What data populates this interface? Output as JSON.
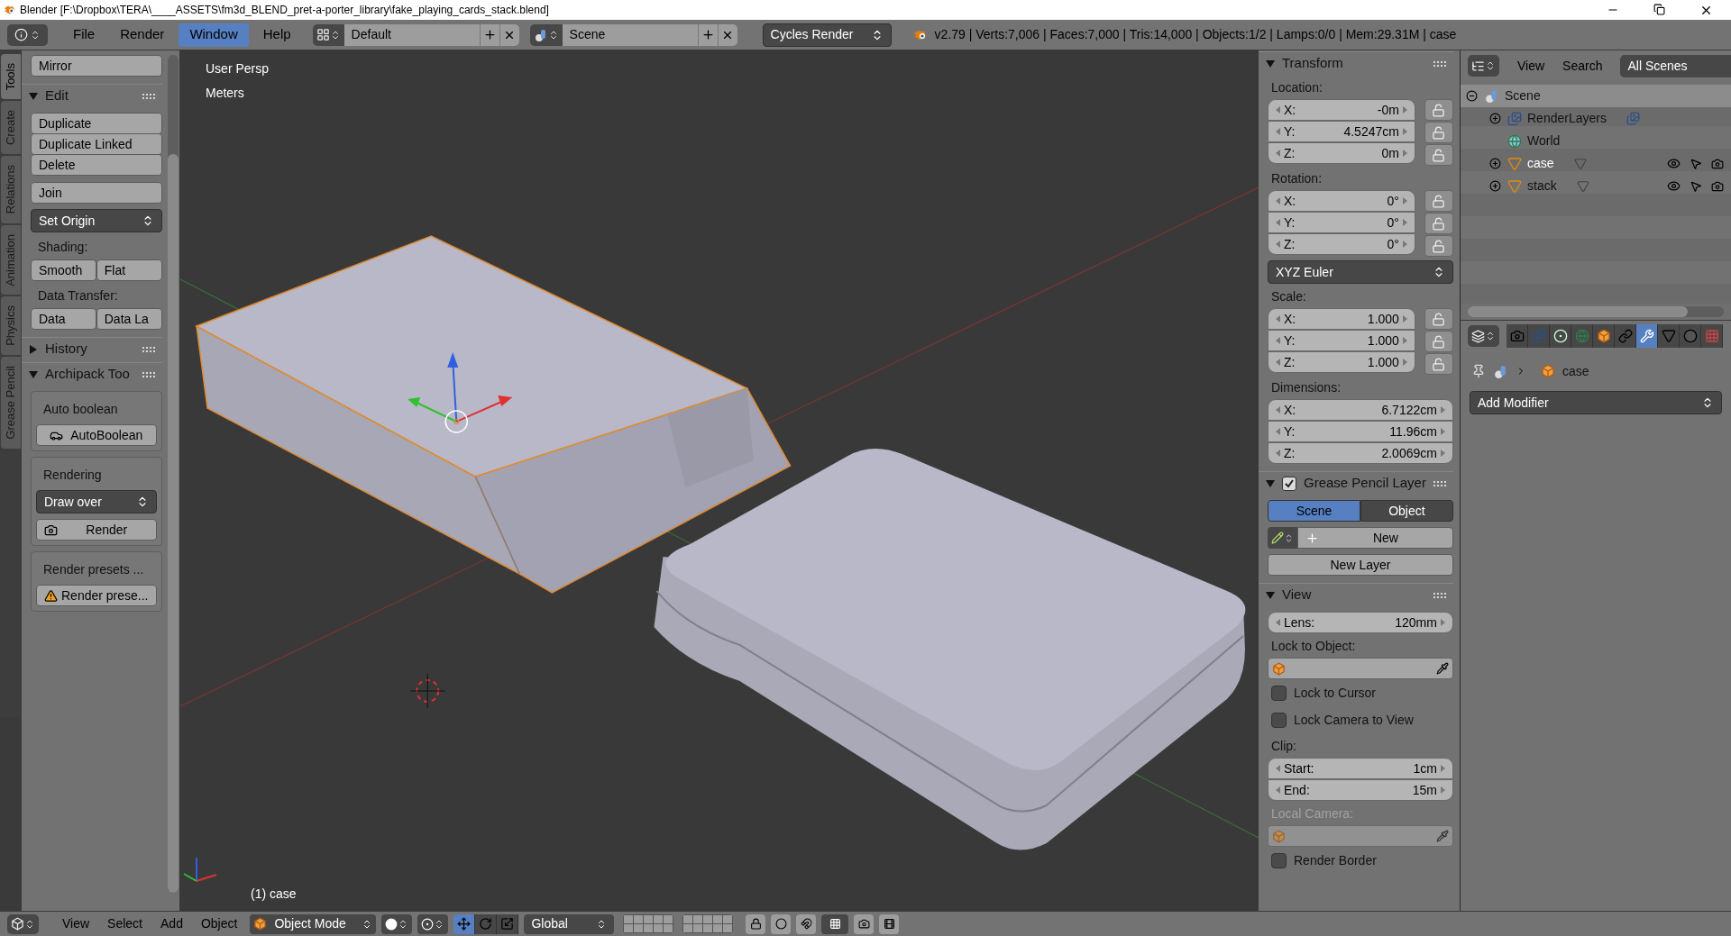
{
  "title_bar": {
    "title": "Blender [F:\\Dropbox\\TERA\\____ASSETS\\fm3d_BLEND_pret-a-porter_library\\fake_playing_cards_stack.blend]"
  },
  "menu": [
    {
      "label": "File",
      "selected": false
    },
    {
      "label": "Render",
      "selected": false
    },
    {
      "label": "Window",
      "selected": true
    },
    {
      "label": "Help",
      "selected": false
    }
  ],
  "screen_layout": "Default",
  "scene": "Scene",
  "render_engine": "Cycles Render",
  "stats": "v2.79 | Verts:7,006 | Faces:7,000 | Tris:14,000 | Objects:1/2 | Lamps:0/0 | Mem:29.31M | case",
  "tool_tabs": [
    {
      "label": "Tools",
      "selected": true
    },
    {
      "label": "Create",
      "selected": false
    },
    {
      "label": "Relations",
      "selected": false
    },
    {
      "label": "Animation",
      "selected": false
    },
    {
      "label": "Physics",
      "selected": false
    },
    {
      "label": "Grease Pencil",
      "selected": false
    }
  ],
  "tools": {
    "top_button": "Mirror",
    "edit": {
      "title": "Edit",
      "expanded": true,
      "buttons": [
        "Duplicate",
        "Duplicate Linked",
        "Delete"
      ],
      "join": "Join",
      "set_origin": "Set Origin",
      "shading_label": "Shading:",
      "shading": [
        "Smooth",
        "Flat"
      ],
      "data_transfer_label": "Data Transfer:",
      "data_transfer": [
        "Data",
        "Data La"
      ]
    },
    "history": {
      "title": "History",
      "expanded": false
    },
    "archipack": {
      "title": "Archipack Too",
      "expanded": true,
      "auto_boolean": {
        "title": "Auto boolean",
        "button": "AutoBoolean"
      },
      "rendering": {
        "title": "Rendering",
        "mode": "Draw over",
        "button": "Render"
      },
      "render_presets": {
        "title": "Render presets ...",
        "button": "Render prese..."
      }
    }
  },
  "viewport": {
    "view": "User Persp",
    "units": "Meters",
    "object": "(1) case"
  },
  "n_panel": {
    "transform": {
      "title": "Transform",
      "expanded": true,
      "location": {
        "label": "Location:",
        "fields": [
          {
            "label": "X:",
            "value": "-0m"
          },
          {
            "label": "Y:",
            "value": "4.5247cm"
          },
          {
            "label": "Z:",
            "value": "0m"
          }
        ]
      },
      "rotation": {
        "label": "Rotation:",
        "fields": [
          {
            "label": "X:",
            "value": "0°"
          },
          {
            "label": "Y:",
            "value": "0°"
          },
          {
            "label": "Z:",
            "value": "0°"
          }
        ]
      },
      "rotation_mode": "XYZ Euler",
      "scale": {
        "label": "Scale:",
        "fields": [
          {
            "label": "X:",
            "value": "1.000"
          },
          {
            "label": "Y:",
            "value": "1.000"
          },
          {
            "label": "Z:",
            "value": "1.000"
          }
        ]
      },
      "dimensions": {
        "label": "Dimensions:",
        "fields": [
          {
            "label": "X:",
            "value": "6.7122cm"
          },
          {
            "label": "Y:",
            "value": "11.96cm"
          },
          {
            "label": "Z:",
            "value": "2.0069cm"
          }
        ]
      }
    },
    "grease_pencil": {
      "title": "Grease Pencil Layer",
      "enabled": true,
      "expanded": true,
      "source": [
        {
          "label": "Scene",
          "selected": true
        },
        {
          "label": "Object",
          "selected": false
        }
      ],
      "new": "New",
      "new_layer": "New Layer"
    },
    "view": {
      "title": "View",
      "expanded": true,
      "lens": {
        "label": "Lens:",
        "value": "120mm"
      },
      "lock_object_label": "Lock to Object:",
      "lock_cursor": {
        "label": "Lock to Cursor",
        "checked": false
      },
      "lock_camera": {
        "label": "Lock Camera to View",
        "checked": false
      },
      "clip_label": "Clip:",
      "clip": [
        {
          "label": "Start:",
          "value": "1cm"
        },
        {
          "label": "End:",
          "value": "15m"
        }
      ],
      "local_camera": {
        "label": "Local Camera:",
        "disabled": true
      },
      "render_border": {
        "label": "Render Border",
        "checked": false
      }
    }
  },
  "outliner": {
    "menus": [
      "View",
      "Search"
    ],
    "display_mode": "All Scenes",
    "tree": [
      {
        "name": "Scene",
        "kind": "scene",
        "expanded": true,
        "selected": true,
        "children": [
          {
            "name": "RenderLayers",
            "kind": "render_layers",
            "expanded": false,
            "selected": false
          },
          {
            "name": "World",
            "kind": "world",
            "selected": false
          },
          {
            "name": "case",
            "kind": "mesh_object",
            "expanded": false,
            "selected": false,
            "active": true
          },
          {
            "name": "stack",
            "kind": "mesh_object",
            "expanded": false,
            "selected": false,
            "active": false
          }
        ]
      }
    ]
  },
  "properties": {
    "tabs": [
      {
        "kind": "render",
        "selected": false
      },
      {
        "kind": "render_layers",
        "selected": false
      },
      {
        "kind": "scene",
        "selected": false
      },
      {
        "kind": "world",
        "selected": false
      },
      {
        "kind": "object",
        "selected": false
      },
      {
        "kind": "constraints",
        "selected": false
      },
      {
        "kind": "modifiers",
        "selected": true
      },
      {
        "kind": "data",
        "selected": false
      },
      {
        "kind": "material",
        "selected": false
      },
      {
        "kind": "texture",
        "selected": false
      }
    ],
    "breadcrumb": "case",
    "add_modifier": "Add Modifier"
  },
  "footer": {
    "menus": [
      "View",
      "Select",
      "Add",
      "Object"
    ],
    "mode": "Object Mode",
    "orientation": "Global",
    "manipulators": [
      {
        "kind": "translate",
        "selected": true
      },
      {
        "kind": "rotate",
        "selected": false
      },
      {
        "kind": "scale",
        "selected": false
      }
    ]
  }
}
